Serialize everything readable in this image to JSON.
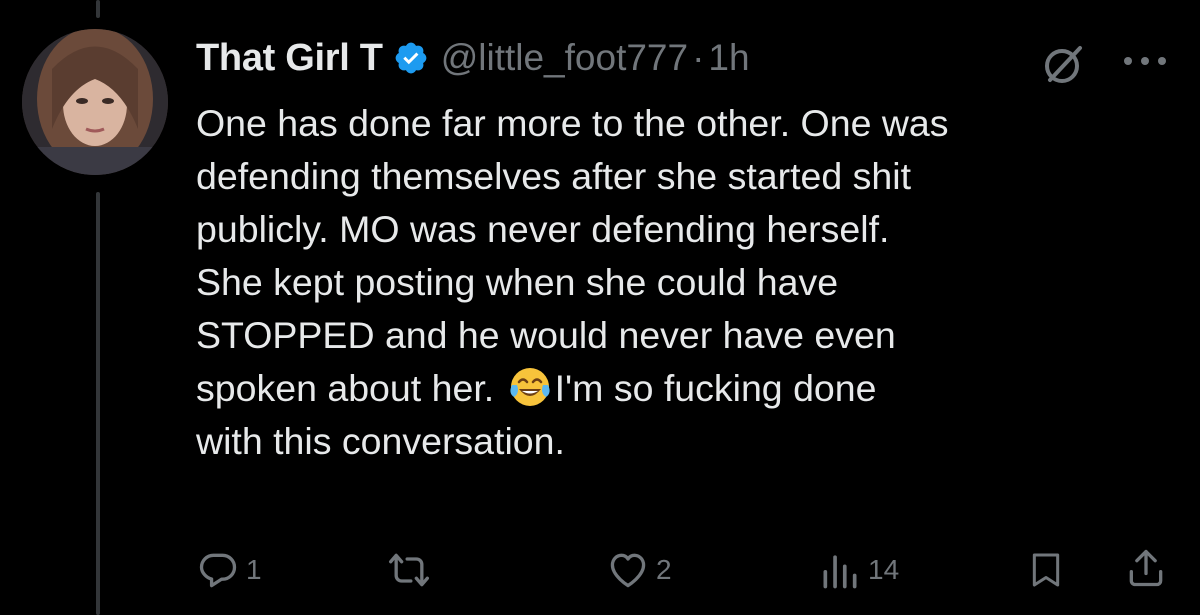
{
  "tweet": {
    "display_name": "That Girl T",
    "handle": "@little_foot777",
    "separator": "·",
    "time": "1h",
    "lines": [
      "One has done far more to the other. One was",
      "defending themselves after she started shit",
      "publicly. MO was never defending herself.",
      "She kept posting when she could have",
      "STOPPED and he would never have even"
    ],
    "line6_before": "spoken about her. ",
    "line6_emoji": "face-with-tears-of-joy-emoji",
    "line6_after": "I'm so fucking done",
    "line7": "with this conversation."
  },
  "actions": {
    "replies": "1",
    "reposts": "",
    "likes": "2",
    "views": "14"
  },
  "icons": {
    "verified": "verified-badge-icon",
    "grok": "grok-icon",
    "more": "more-icon",
    "reply": "reply-icon",
    "repost": "repost-icon",
    "like": "like-icon",
    "views": "views-icon",
    "bookmark": "bookmark-icon",
    "share": "share-icon"
  },
  "colors": {
    "background": "#000000",
    "text": "#e7e9ea",
    "muted": "#71767b",
    "verified": "#1d9bf0"
  }
}
